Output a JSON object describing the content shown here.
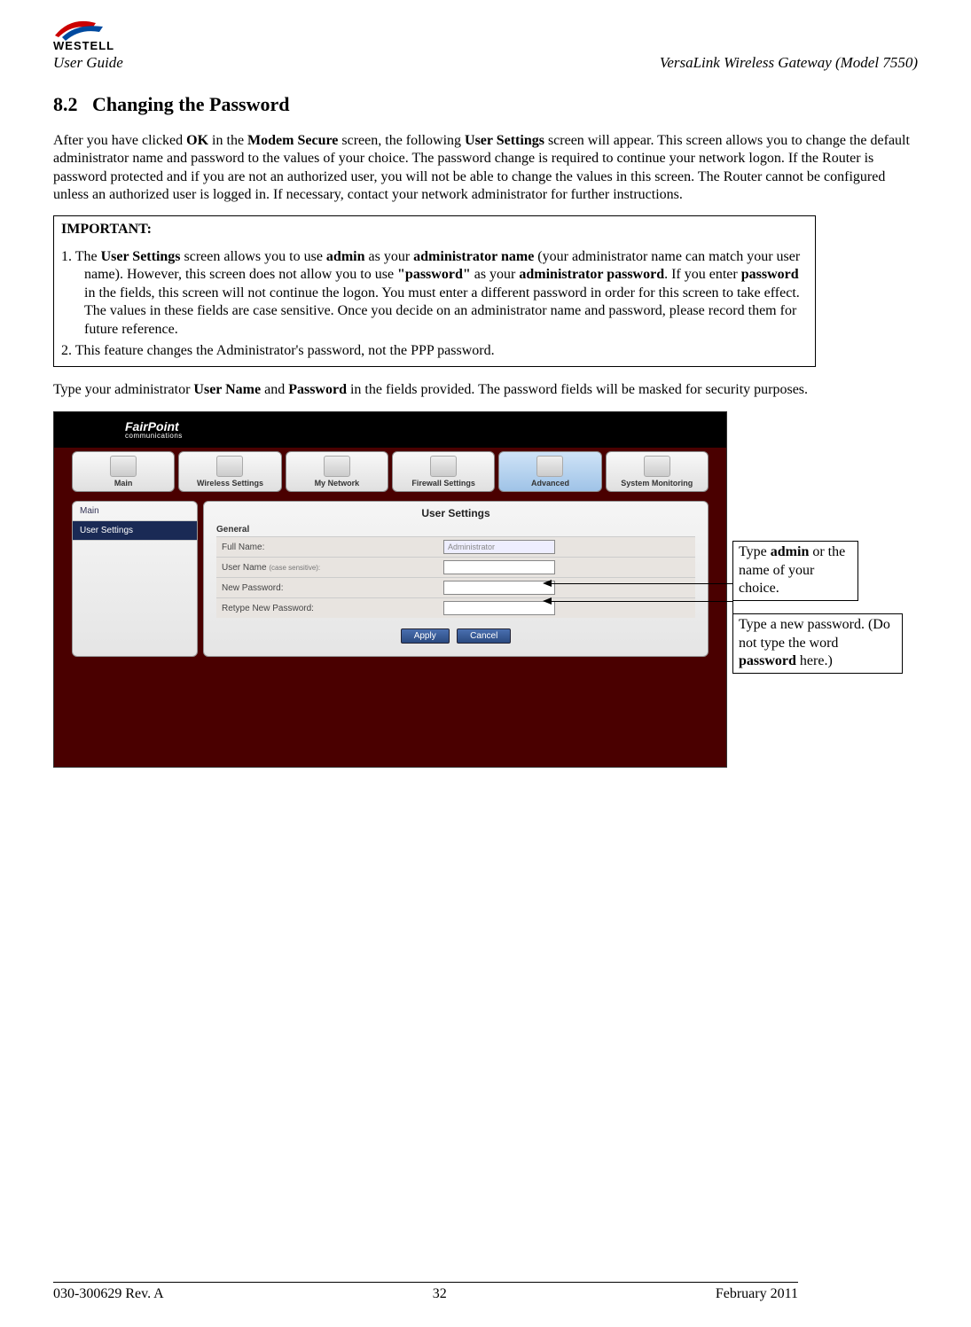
{
  "brand": "WESTELL",
  "header_left": "User Guide",
  "header_right": "VersaLink Wireless Gateway (Model 7550)",
  "section_number": "8.2",
  "section_title": "Changing the Password",
  "intro_1a": "After you have clicked ",
  "intro_ok": "OK",
  "intro_1b": " in the ",
  "intro_modemsecure": "Modem Secure",
  "intro_1c": " screen, the following ",
  "intro_usersettings": "User Settings",
  "intro_1d": " screen will appear. This screen allows you to change the default administrator name and password to the values of your choice. The password change is required to continue your network logon. If the Router is password protected and if you are not an authorized user, you will not be able to change the values in this screen. The Router cannot be configured unless an authorized user is logged in. If necessary, contact your network administrator for further instructions.",
  "important_label": "IMPORTANT:",
  "imp1_a": "1. The ",
  "imp1_usersettings": "User Settings",
  "imp1_b": " screen allows you to use ",
  "imp1_admin": "admin",
  "imp1_c": " as your ",
  "imp1_adminname": "administrator name",
  "imp1_d": " (your administrator name can match your user name). However, this screen does not allow you to use ",
  "imp1_passwordq": "\"password\"",
  "imp1_e": " as your ",
  "imp1_adminpw": "administrator password",
  "imp1_f": ". If you enter ",
  "imp1_password": "password",
  "imp1_g": " in the fields, this screen will not continue the logon. You must enter a different password in order for this screen to take effect. The values in these fields are case sensitive. Once you decide on an administrator name and password, please record them for future reference.",
  "imp2": "2. This feature changes the Administrator's password, not the PPP password.",
  "type_a": "Type your administrator ",
  "type_username": "User Name",
  "type_b": " and ",
  "type_password": "Password",
  "type_c": " in the fields provided. The password fields will be masked for security purposes.",
  "figure": {
    "brand_top": "FairPoint",
    "brand_sub": "communications",
    "nav": [
      "Main",
      "Wireless Settings",
      "My Network",
      "Firewall Settings",
      "Advanced",
      "System Monitoring"
    ],
    "side": [
      "Main",
      "User Settings"
    ],
    "panel_title": "User Settings",
    "general": "General",
    "rows": {
      "fullname": "Full Name:",
      "fullname_val": "Administrator",
      "username": "User Name",
      "case": "(case sensitive):",
      "newpw": "New Password:",
      "retype": "Retype New Password:"
    },
    "buttons": {
      "apply": "Apply",
      "cancel": "Cancel"
    }
  },
  "callout1_a": "Type ",
  "callout1_admin": "admin",
  "callout1_b": " or the name of your choice.",
  "callout2_a": "Type a new password. (Do not type the word ",
  "callout2_pw": "password",
  "callout2_b": " here.)",
  "footer": {
    "left": "030-300629 Rev. A",
    "center": "32",
    "right": "February 2011"
  }
}
